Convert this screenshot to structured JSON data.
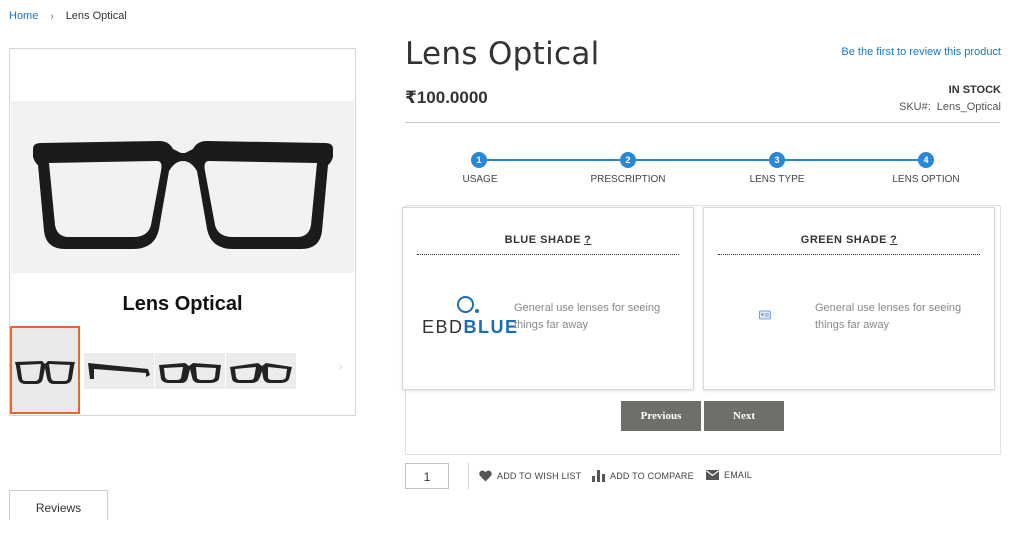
{
  "breadcrumb": {
    "home": "Home",
    "separator": "›",
    "current": "Lens Optical"
  },
  "gallery": {
    "main_title": "Lens Optical",
    "thumbnail_count": 4,
    "active_thumbnail": 1,
    "next_arrow": "›",
    "accent_color": "#e8662e"
  },
  "product": {
    "title": "Lens Optical",
    "review_link": "Be the first to review this product",
    "price": "₹100.0000",
    "stock": "IN STOCK",
    "sku_label": "SKU#:",
    "sku_value": "Lens_Optical"
  },
  "steps": {
    "color": "#2a86d6",
    "items": [
      {
        "number": "1",
        "label": "USAGE"
      },
      {
        "number": "2",
        "label": "PRESCRIPTION"
      },
      {
        "number": "3",
        "label": "LENS TYPE"
      },
      {
        "number": "4",
        "label": "LENS OPTION"
      }
    ]
  },
  "options": [
    {
      "title": "BLUE SHADE",
      "help": "?",
      "description": "General use lenses for seeing things far away",
      "brand_ebd": "EBD",
      "brand_blue": "BLUE"
    },
    {
      "title": "GREEN SHADE",
      "help": "?",
      "description": "General use lenses for seeing things far away",
      "icon": "id-card-icon"
    }
  ],
  "buttons": {
    "previous": "Previous",
    "next": "Next",
    "color": "#6e6e6b"
  },
  "actions": {
    "qty": "1",
    "wishlist": "ADD TO WISH LIST",
    "compare": "ADD TO COMPARE",
    "email": "EMAIL"
  },
  "tabs": {
    "reviews": "Reviews"
  }
}
